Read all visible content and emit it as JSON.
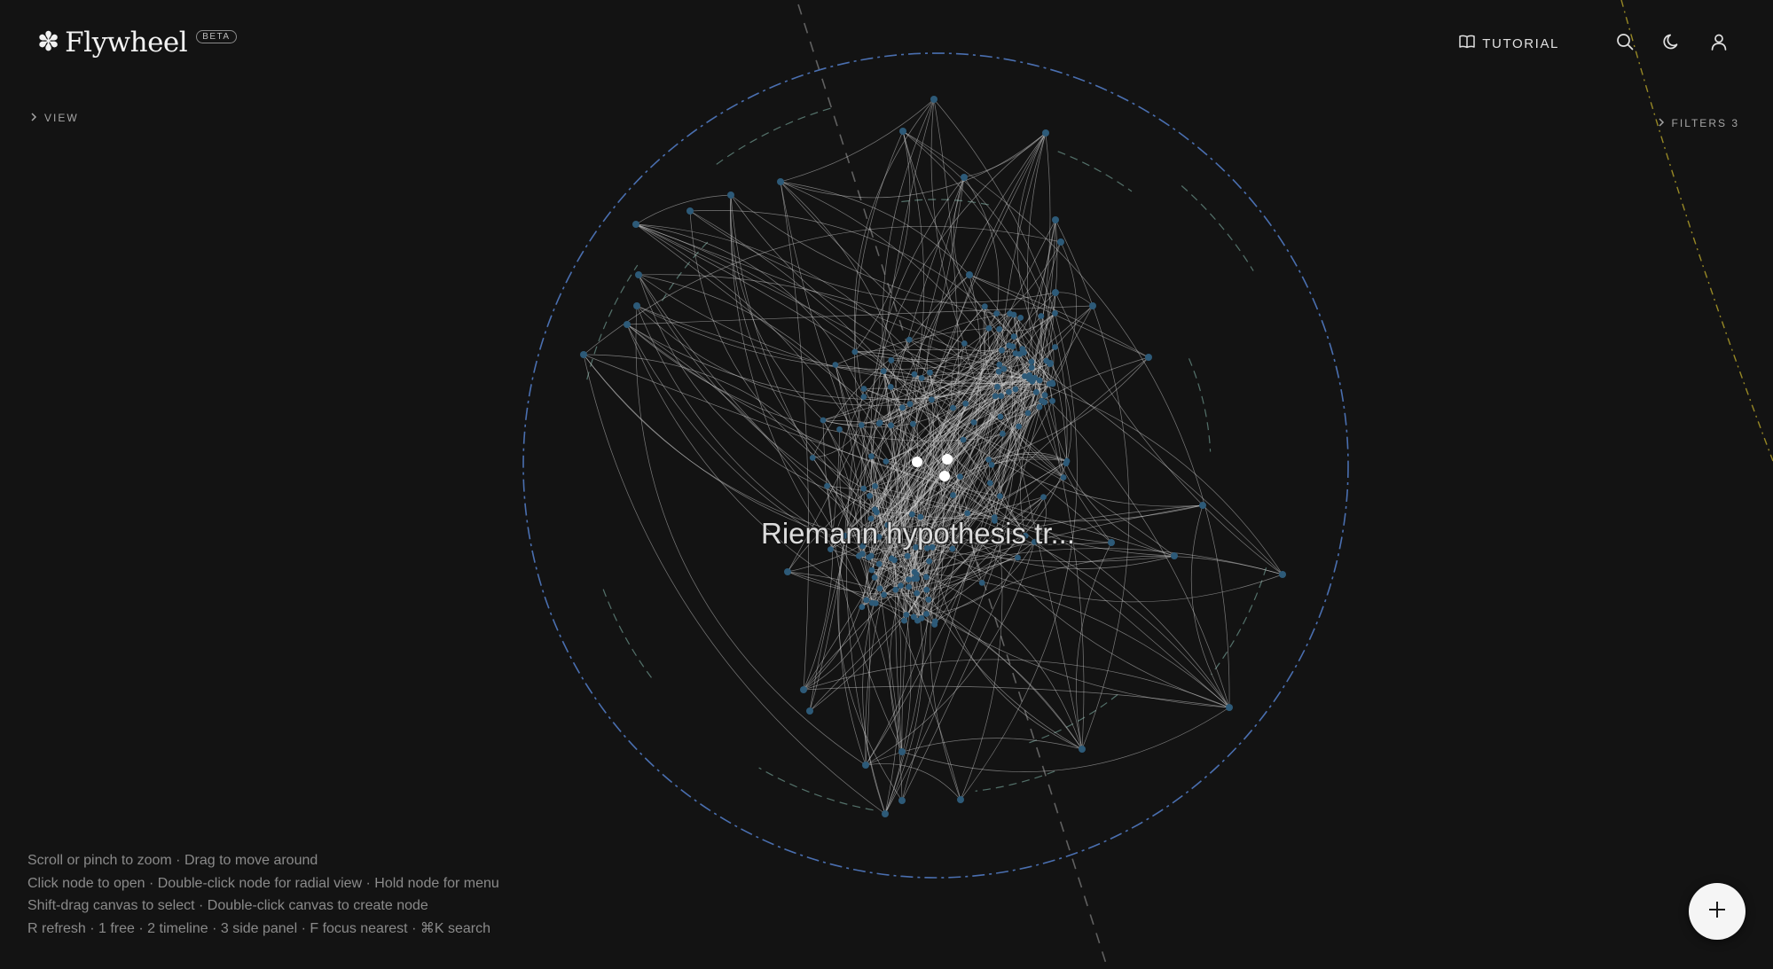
{
  "app": {
    "name": "Flywheel",
    "badge": "BETA",
    "logo_icon": "asterisk-flower-icon"
  },
  "header": {
    "tutorial_label": "TUTORIAL",
    "tutorial_icon": "book-icon",
    "search_icon": "search-icon",
    "theme_icon": "moon-icon",
    "account_icon": "user-icon"
  },
  "panels": {
    "view_label": "VIEW",
    "filters_label": "FILTERS 3"
  },
  "graph": {
    "focused_label": "Riemann hypothesis tr...",
    "node_color": "#2d5a78",
    "edge_color": "#cfcfcf",
    "outer_ring_color": "#4a6fb0",
    "guide_line_color": "#7a7a7a",
    "accent_line_color": "#b9a62a"
  },
  "help": {
    "line1": "Scroll or pinch to zoom · Drag to move around",
    "line2": "Click node to open · Double-click node for radial view · Hold node for menu",
    "line3": "Shift-drag canvas to select · Double-click canvas to create node",
    "line4": "R refresh · 1 free · 2 timeline · 3 side panel · F focus nearest · ⌘K search"
  },
  "fab": {
    "icon": "plus-icon"
  }
}
